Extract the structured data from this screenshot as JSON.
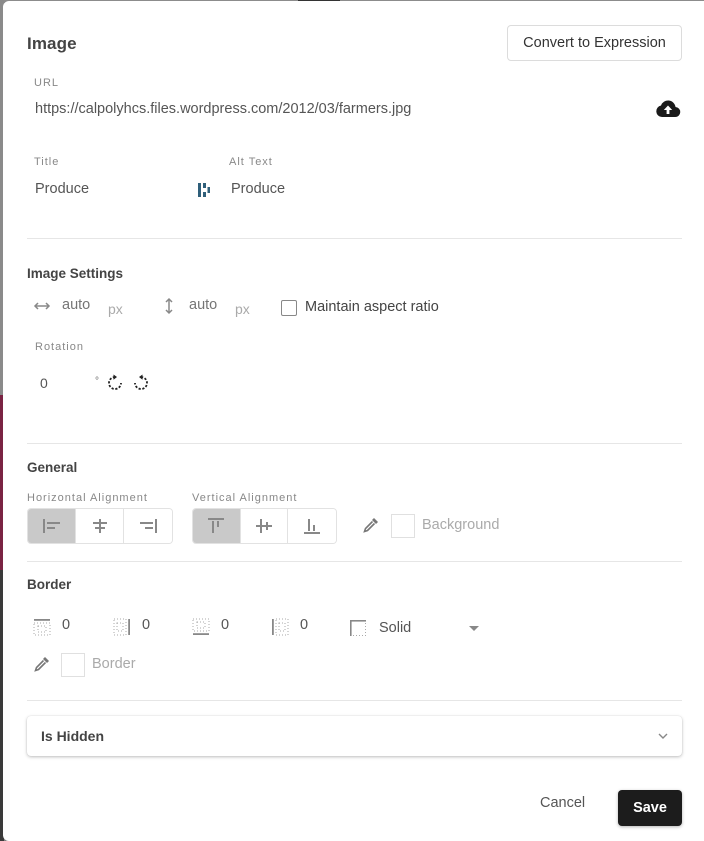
{
  "modal": {
    "title": "Image",
    "convert_button": "Convert to Expression"
  },
  "url": {
    "label": "URL",
    "value": "https://calpolyhcs.files.wordpress.com/2012/03/farmers.jpg",
    "upload_icon": "cloud-upload-icon"
  },
  "title_field": {
    "label": "Title",
    "value": "Produce"
  },
  "link_icon": "link-toggle-icon",
  "alt_field": {
    "label": "Alt Text",
    "value": "Produce"
  },
  "image_settings": {
    "heading": "Image Settings",
    "width": {
      "icon": "width-arrows-icon",
      "placeholder": "auto",
      "unit": "px"
    },
    "height": {
      "icon": "height-arrows-icon",
      "placeholder": "auto",
      "unit": "px"
    },
    "maintain_aspect_ratio": {
      "label": "Maintain aspect ratio",
      "checked": false
    },
    "rotation": {
      "label": "Rotation",
      "value": "0",
      "unit": "°",
      "rotate_cw_icon": "rotate-clockwise-icon",
      "rotate_ccw_icon": "rotate-counterclockwise-icon"
    }
  },
  "general": {
    "heading": "General",
    "horizontal_alignment": {
      "label": "Horizontal Alignment",
      "options": [
        "left",
        "center",
        "right"
      ],
      "selected": "left"
    },
    "vertical_alignment": {
      "label": "Vertical Alignment",
      "options": [
        "top",
        "middle",
        "bottom"
      ],
      "selected": "top"
    },
    "background": {
      "label": "Background",
      "icon": "eyedropper-icon",
      "color": "#ffffff"
    }
  },
  "border": {
    "heading": "Border",
    "widths": [
      {
        "side": "top",
        "value": "0"
      },
      {
        "side": "right",
        "value": "0"
      },
      {
        "side": "bottom",
        "value": "0"
      },
      {
        "side": "left",
        "value": "0"
      }
    ],
    "style": {
      "value": "Solid"
    },
    "color": {
      "label": "Border",
      "icon": "eyedropper-icon",
      "color": "#ffffff"
    }
  },
  "is_hidden": {
    "label": "Is Hidden"
  },
  "footer": {
    "cancel": "Cancel",
    "save": "Save"
  },
  "colors": {
    "primary_button": "#1c1c1c",
    "active_segment": "#c9c9c9",
    "link_icon": "#2f5f7a"
  }
}
